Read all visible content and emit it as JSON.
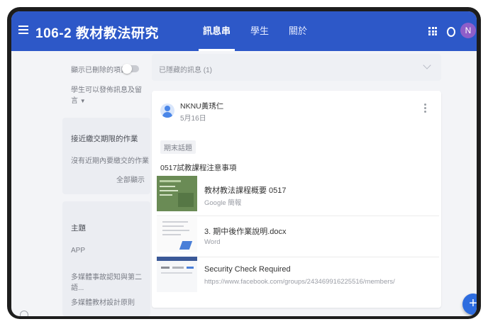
{
  "header": {
    "class_title": "106-2 教材教法研究",
    "tabs": [
      {
        "label": "訊息串",
        "active": true
      },
      {
        "label": "學生",
        "active": false
      },
      {
        "label": "關於",
        "active": false
      }
    ],
    "avatar_initial": "N",
    "icons": [
      "menu-icon",
      "apps-icon",
      "notifications-icon"
    ],
    "colors": {
      "bar": "#2d58c8",
      "avatar": "#8e5ec9"
    }
  },
  "sidebar": {
    "show_deleted_label": "顯示已刪除的項目",
    "student_permissions_label": "學生可以發佈訊息及留言",
    "upcoming": {
      "title": "接近繳交期限的作業",
      "empty_text": "沒有近期內要繳交的作業",
      "view_all": "全部顯示"
    },
    "topics": {
      "title": "主題",
      "items": [
        "APP",
        "多媒體事故認知與第二語...",
        "多媒體教材設計原則"
      ]
    }
  },
  "stream": {
    "collapsed_header": "已隱藏的訊息 (1)",
    "post": {
      "author": "NKNU黃琇仁",
      "date": "5月16日",
      "tag": "期末話題",
      "text": "0517試教課程注意事項",
      "attachments": [
        {
          "title": "教材教法課程概要 0517",
          "subtitle": "Google 簡報"
        },
        {
          "title": "3. 期中後作業說明.docx",
          "subtitle": "Word"
        },
        {
          "title": "Security Check Required",
          "subtitle": "https://www.facebook.com/groups/243469916225516/members/"
        }
      ]
    }
  },
  "fab_label": "+"
}
